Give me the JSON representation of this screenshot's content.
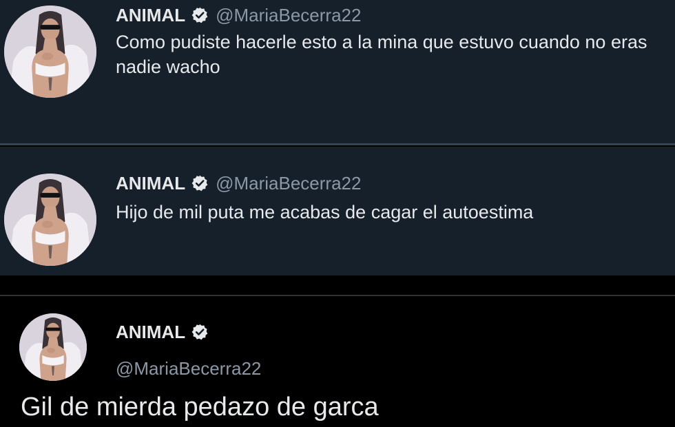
{
  "tweets": [
    {
      "name": "ANIMAL",
      "handle": "@MariaBecerra22",
      "text": "Como pudiste hacerle esto a la mina que estuvo cuando no eras nadie wacho",
      "verified": true
    },
    {
      "name": "ANIMAL",
      "handle": "@MariaBecerra22",
      "text": "Hijo de mil puta me acabas de cagar el autoestima",
      "verified": true
    },
    {
      "name": "ANIMAL",
      "handle": "@MariaBecerra22",
      "text": "Gil de mierda pedazo de garca",
      "verified": true
    }
  ],
  "icons": {
    "badge": "verified-badge-icon",
    "avatar": "profile-avatar"
  },
  "colors": {
    "dim_bg": "#15202b",
    "black_bg": "#000000",
    "text": "#e7e9ea",
    "muted": "#8b98a5"
  }
}
